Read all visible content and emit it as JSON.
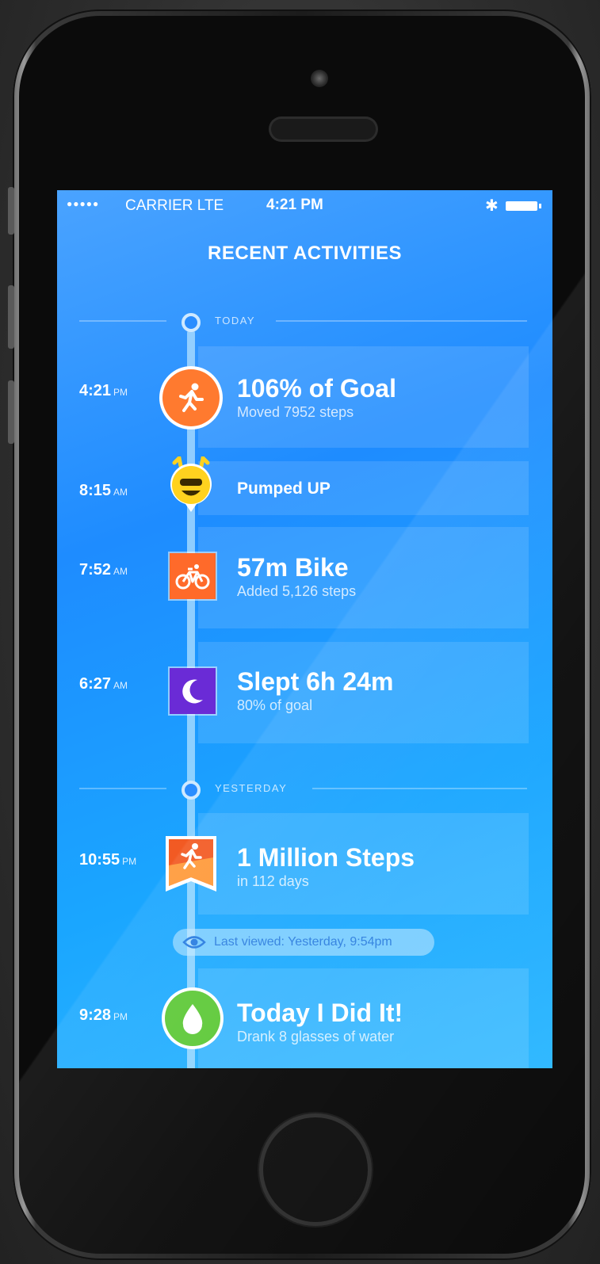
{
  "status_bar": {
    "signal": "●●●●●",
    "carrier": "CARRIER LTE",
    "time": "4:21 PM"
  },
  "screen_title": "RECENT ACTIVITIES",
  "sections": [
    {
      "label": "TODAY"
    },
    {
      "label": "YESTERDAY"
    }
  ],
  "activities": [
    {
      "time": "4:21",
      "ampm": "PM",
      "title": "106% of Goal",
      "subtitle": "Moved 7952 steps",
      "icon": "running-icon",
      "icon_color": "#ff7a2f"
    },
    {
      "time": "8:15",
      "ampm": "AM",
      "title": "Pumped UP",
      "subtitle": "",
      "icon": "mood-face-icon",
      "icon_color": "#ffd21f"
    },
    {
      "time": "7:52",
      "ampm": "AM",
      "title": "57m Bike",
      "subtitle": "Added 5,126 steps",
      "icon": "bike-icon",
      "icon_color": "#ff6a2a"
    },
    {
      "time": "6:27",
      "ampm": "AM",
      "title": "Slept 6h 24m",
      "subtitle": "80% of goal",
      "icon": "moon-icon",
      "icon_color": "#6a2bd6"
    },
    {
      "time": "10:55",
      "ampm": "PM",
      "title": "1 Million Steps",
      "subtitle": "in 112 days",
      "icon": "badge-running-icon",
      "icon_color": "#f25a23"
    },
    {
      "time": "9:28",
      "ampm": "PM",
      "title": "Today I Did It!",
      "subtitle": "Drank 8 glasses of water",
      "icon": "water-drop-icon",
      "icon_color": "#5fc93a"
    }
  ],
  "last_viewed": "Last viewed: Yesterday, 9:54pm"
}
